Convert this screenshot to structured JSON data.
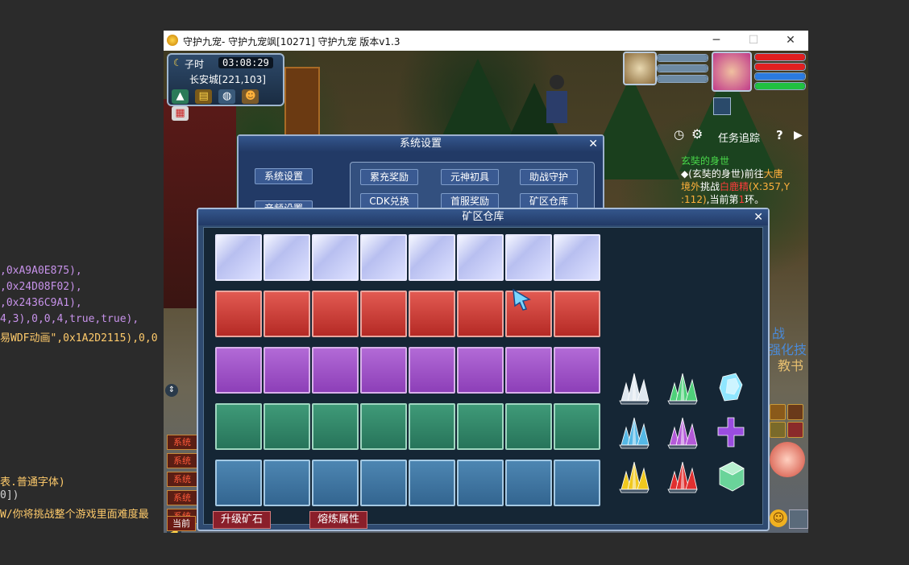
{
  "code_lines": [
    {
      "segments": [
        {
          "t": ",0xA9A0E875),",
          "c": "p"
        }
      ]
    },
    {
      "segments": [
        {
          "t": ",0x24D08F02),",
          "c": "p"
        }
      ]
    },
    {
      "segments": [
        {
          "t": ",0x2436C9A1),",
          "c": "p"
        }
      ]
    },
    {
      "segments": [
        {
          "t": "4,3),0,0,4,true,true),",
          "c": "p"
        }
      ]
    },
    {
      "segments": [
        {
          "t": "易WDF动画\",0x1A2D2115),0,0",
          "c": "y"
        }
      ]
    },
    {
      "segments": [
        {
          "t": "表.普通字体)",
          "c": "y"
        }
      ]
    },
    {
      "segments": [
        {
          "t": "0])",
          "c": "w"
        }
      ]
    },
    {
      "segments": [
        {
          "t": "W/你将挑战整个游戏里面难度最",
          "c": "y"
        }
      ]
    }
  ],
  "window": {
    "title": "守护九宠- 守护九宠飒[10271] 守护九宠 版本v1.3",
    "minimize": "─",
    "maximize": "☐",
    "close": "✕"
  },
  "hud": {
    "shichen": "子时",
    "time": "03:08:29",
    "location": "长安城[221,103]"
  },
  "quest_tracker": {
    "title": "任务追踪",
    "help": "?",
    "quest_name": "玄奘的身世",
    "line1_a": "◆(玄奘的身世)前往",
    "line1_b": "大唐",
    "line2_a": "境外",
    "line2_b": "挑战",
    "line2_c": "白鹿精",
    "line2_d": "(X:357,Y",
    "line3_a": ":112)",
    "line3_b": ",当前第",
    "line3_c": "1",
    "line3_d": "环。"
  },
  "bg_text": {
    "a": "战",
    "b": "强化技",
    "c": "教书"
  },
  "chat_tabs": [
    "系统",
    "系统",
    "系统",
    "系统",
    "系统"
  ],
  "chat_bottom": "当前",
  "settings": {
    "title": "系统设置",
    "close": "✕",
    "side": [
      "系统设置",
      "音频设置"
    ],
    "buttons": [
      "累充奖励",
      "元神初具",
      "助战守护",
      "CDK兑换",
      "首服奖励",
      "矿区仓库"
    ]
  },
  "warehouse": {
    "title": "矿区仓库",
    "close": "✕",
    "upgrade_button": "升级矿石",
    "smelt_button": "熔炼属性",
    "rows": [
      "white",
      "red",
      "purple",
      "green",
      "blue"
    ],
    "columns": 8,
    "ores": [
      {
        "name": "white-crystal-ore",
        "color": "#dfe8f0"
      },
      {
        "name": "green-crystal-ore",
        "color": "#4fd07a"
      },
      {
        "name": "cyan-gem-ore",
        "color": "#8fe6ff"
      },
      {
        "name": "blue-crystal-ore",
        "color": "#55b8e6"
      },
      {
        "name": "purple-crystal-ore",
        "color": "#b45ad8"
      },
      {
        "name": "purple-cross-gem",
        "color": "#9a4de0"
      },
      {
        "name": "yellow-crystal-ore",
        "color": "#f0c81e"
      },
      {
        "name": "red-crystal-ore",
        "color": "#e03030"
      },
      {
        "name": "green-block-gem",
        "color": "#6ad49a"
      }
    ]
  }
}
